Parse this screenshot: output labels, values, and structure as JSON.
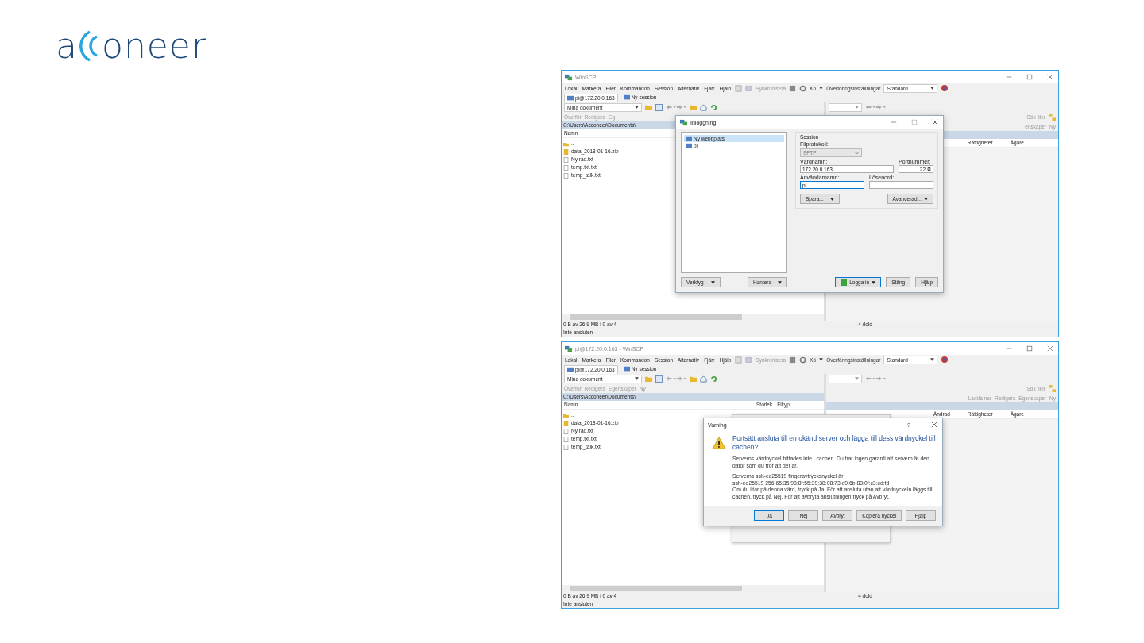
{
  "logo": {
    "lead": "a",
    "tail": "oneer"
  },
  "windows": [
    {
      "title": "WinSCP",
      "menu": [
        "Lokal",
        "Markera",
        "Filer",
        "Kommandon",
        "Session",
        "Alternativ",
        "Fjärr",
        "Hjälp"
      ],
      "sync": "Synkronisera",
      "queue": "Kö",
      "transfer_label": "Överföringsinställningar",
      "transfer_value": "Standard",
      "tabs": [
        {
          "label": "pi@172.20.0.163",
          "selected": true
        },
        {
          "label": "Ny session",
          "selected": false
        }
      ],
      "local_drive": "Mina dokument",
      "local_actions": [
        "Överför",
        "Redigera",
        "Eg"
      ],
      "remote_search": "Sök filer",
      "remote_actions": [
        "enskaper",
        "Ny"
      ],
      "path": "C:\\Users\\Acconeer\\Documents\\",
      "local_columns": [
        "Namn"
      ],
      "files": [
        {
          "name": "..",
          "kind": "parent"
        },
        {
          "name": "data_2018-01-16.zip",
          "kind": "zip"
        },
        {
          "name": "Ny rad.txt",
          "kind": "text"
        },
        {
          "name": "temp.txt.txt",
          "kind": "text"
        },
        {
          "name": "temp_talk.txt",
          "kind": "text"
        }
      ],
      "remote_columns": [
        "Rättigheter",
        "Ägare"
      ],
      "status_left": "0 B av 26,9 MB i 0 av 4",
      "status_right": "4 dold",
      "connection": "Inte ansluten",
      "dialog": {
        "kind": "login",
        "title": "Inloggning",
        "sites": [
          {
            "label": "Ny webbplats",
            "selected": true
          },
          {
            "label": "pi",
            "selected": false
          }
        ],
        "group": "Session",
        "protocol_label": "Filprotokoll:",
        "protocol": "SFTP",
        "host_label": "Värdnamn:",
        "host": "172.20.0.163",
        "port_label": "Portnummer:",
        "port": "22",
        "user_label": "Användarnamn:",
        "user": "pi",
        "password_label": "Lösenord:",
        "save": "Spara...",
        "advanced": "Avancerad...",
        "tools": "Verktyg",
        "manage": "Hantera",
        "login": "Logga in",
        "close": "Stäng",
        "help": "Hjälp"
      }
    },
    {
      "title": "pi@172.20.0.163 - WinSCP",
      "menu": [
        "Lokal",
        "Markera",
        "Filer",
        "Kommandon",
        "Session",
        "Alternativ",
        "Fjärr",
        "Hjälp"
      ],
      "sync": "Synkronisera",
      "queue": "Kö",
      "transfer_label": "Överföringsinställningar",
      "transfer_value": "Standard",
      "tabs": [
        {
          "label": "pi@172.20.0.163",
          "selected": true
        },
        {
          "label": "Ny session",
          "selected": false
        }
      ],
      "local_drive": "Mina dokument",
      "local_actions": [
        "Överför",
        "Redigera",
        "Egenskaper",
        "Ny"
      ],
      "remote_search": "Sök filer",
      "remote_actions": [
        "Ladda ner",
        "Redigera",
        "Egenskaper",
        "Ny"
      ],
      "path": "C:\\Users\\Acconeer\\Documents\\",
      "local_columns": [
        "Namn",
        "Storlek",
        "Filtyp"
      ],
      "files": [
        {
          "name": "..",
          "kind": "parent"
        },
        {
          "name": "data_2018-01-16.zip",
          "kind": "zip"
        },
        {
          "name": "Ny rad.txt",
          "kind": "text"
        },
        {
          "name": "temp.txt.txt",
          "kind": "text"
        },
        {
          "name": "temp_talk.txt",
          "kind": "text"
        }
      ],
      "remote_columns": [
        "Ändrad",
        "Rättigheter",
        "Ägare"
      ],
      "status_left": "0 B av 26,9 MB i 0 av 4",
      "status_right": "4 dold",
      "connection": "Inte ansluten",
      "dialog": {
        "kind": "warning",
        "title": "Varning",
        "help_mark": "?",
        "heading": "Fortsätt ansluta till en okänd server och lägga till dess värdnyckel till cachen?",
        "paragraphs": [
          "Serverns värdnyckel hittades inte i cachen. Du har ingen garanti att servern är den dator som du tror att det är.",
          "Serverns ssh-ed25519 fingeravtrycksnyckel är:\nssh-ed25519 256 65:35:98:8f:55:39:38:08:73:d9:6b:83:0f:c3:cd:fd\nOm du litar på denna värd, tryck på Ja. För att ansluta utan att värdnyckeln läggs till cachen, tryck på Nej. För att avbryta anslutningen tryck på Avbryt."
        ],
        "buttons": [
          {
            "label": "Ja",
            "default": true
          },
          {
            "label": "Nej",
            "default": false
          },
          {
            "label": "Avbryt",
            "default": false
          },
          {
            "label": "Kopiera nyckel",
            "default": false
          },
          {
            "label": "Hjälp",
            "default": false
          }
        ]
      }
    }
  ]
}
